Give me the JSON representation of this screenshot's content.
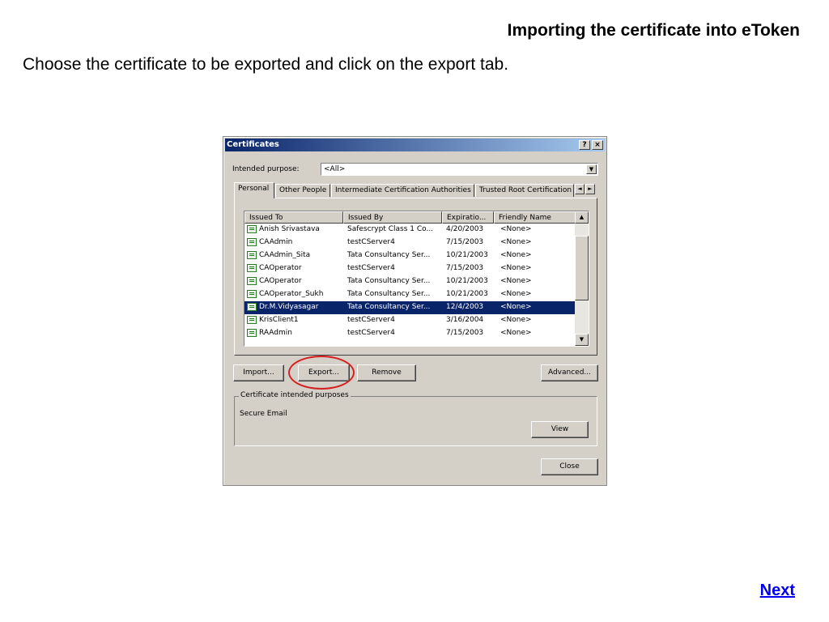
{
  "slide": {
    "title": "Importing the certificate into eToken",
    "instruction": "Choose the certificate to be exported and click on the export tab.",
    "next_link": "Next"
  },
  "dialog": {
    "title": "Certificates",
    "help_btn": "?",
    "close_btn": "×",
    "purpose_label": "Intended purpose:",
    "purpose_value": "<All>",
    "tabs": [
      "Personal",
      "Other People",
      "Intermediate Certification Authorities",
      "Trusted Root Certification"
    ],
    "columns": [
      "Issued To",
      "Issued By",
      "Expiratio...",
      "Friendly Name"
    ],
    "rows": [
      {
        "to": "Anish Srivastava",
        "by": "Safescrypt Class 1 Co...",
        "exp": "4/20/2003",
        "name": "<None>"
      },
      {
        "to": "CAAdmin",
        "by": "testCServer4",
        "exp": "7/15/2003",
        "name": "<None>"
      },
      {
        "to": "CAAdmin_Sita",
        "by": "Tata Consultancy Ser...",
        "exp": "10/21/2003",
        "name": "<None>"
      },
      {
        "to": "CAOperator",
        "by": "testCServer4",
        "exp": "7/15/2003",
        "name": "<None>"
      },
      {
        "to": "CAOperator",
        "by": "Tata Consultancy Ser...",
        "exp": "10/21/2003",
        "name": "<None>"
      },
      {
        "to": "CAOperator_Sukh",
        "by": "Tata Consultancy Ser...",
        "exp": "10/21/2003",
        "name": "<None>"
      },
      {
        "to": "Dr.M.Vidyasagar",
        "by": "Tata Consultancy Ser...",
        "exp": "12/4/2003",
        "name": "<None>"
      },
      {
        "to": "KrisClient1",
        "by": "testCServer4",
        "exp": "3/16/2004",
        "name": "<None>"
      },
      {
        "to": "RAAdmin",
        "by": "testCServer4",
        "exp": "7/15/2003",
        "name": "<None>"
      }
    ],
    "selected_row": 6,
    "buttons": {
      "import": "Import...",
      "export": "Export...",
      "remove": "Remove",
      "advanced": "Advanced...",
      "view": "View",
      "close": "Close"
    },
    "purposes_group_label": "Certificate intended purposes",
    "purposes_text": "Secure Email"
  },
  "colors": {
    "dialog_bg": "#d4d0c8",
    "titlebar": "#0a246a",
    "selection": "#0a246a",
    "highlight_ellipse": "#d42020",
    "link": "#0000ee"
  }
}
